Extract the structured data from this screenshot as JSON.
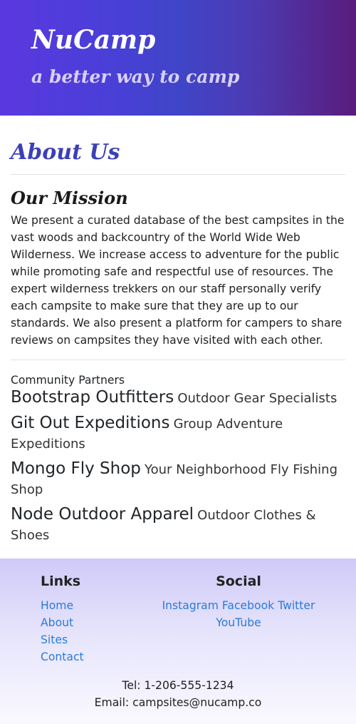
{
  "header": {
    "brand": "NuCamp",
    "tagline": "a better way to camp"
  },
  "main": {
    "title": "About Us",
    "mission": {
      "title": "Our Mission",
      "text": "We present a curated database of the best campsites in the vast woods and backcountry of the World Wide Web Wilderness. We increase access to adventure for the public while promoting safe and respectful use of resources. The expert wilderness trekkers on our staff personally verify each campsite to make sure that they are up to our standards. We also present a platform for campers to share reviews on campsites they have visited with each other."
    },
    "partners": {
      "heading": "Community Partners",
      "items": [
        {
          "name": "Bootstrap Outfitters",
          "desc": "Outdoor Gear Specialists"
        },
        {
          "name": "Git Out Expeditions",
          "desc": "Group Adventure Expeditions"
        },
        {
          "name": "Mongo Fly Shop",
          "desc": "Your Neighborhood Fly Fishing Shop"
        },
        {
          "name": "Node Outdoor Apparel",
          "desc": "Outdoor Clothes & Shoes"
        }
      ]
    }
  },
  "footer": {
    "links_title": "Links",
    "links": [
      "Home",
      "About",
      "Sites",
      "Contact"
    ],
    "social_title": "Social",
    "social": [
      "Instagram",
      "Facebook",
      "Twitter",
      "YouTube"
    ],
    "phone": "Tel: 1-206-555-1234",
    "email": "Email: campsites@nucamp.co"
  },
  "colors": {
    "brand_accent": "#3b3fb8",
    "link": "#2b7bd8"
  }
}
